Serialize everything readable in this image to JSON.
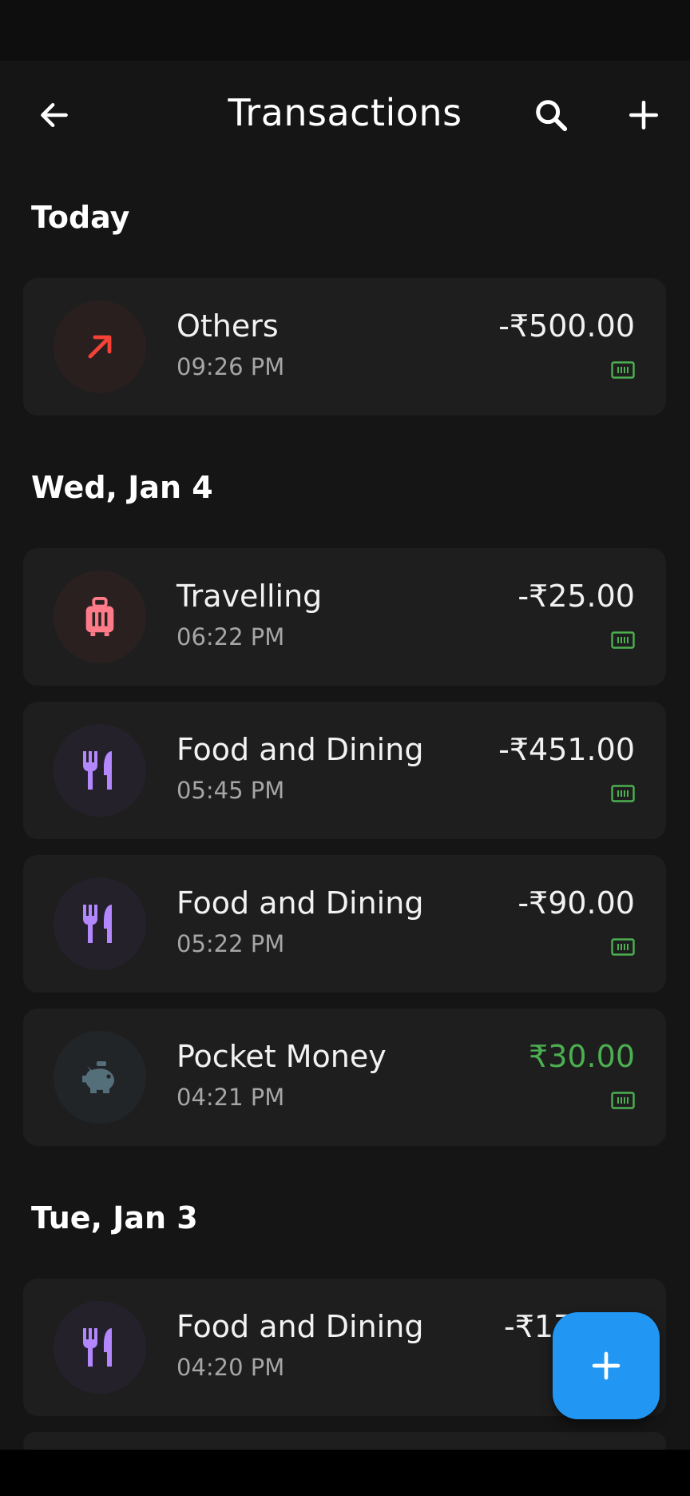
{
  "header": {
    "title": "Transactions"
  },
  "icons": {
    "back": "arrow-left-icon",
    "search": "search-icon",
    "add": "plus-icon",
    "fab": "plus-icon",
    "wallet": "cash-icon"
  },
  "colors": {
    "background": "#151515",
    "card": "#1e1e1f",
    "income": "#4caf50",
    "fab": "#2196f3",
    "wallet": "#4caf50"
  },
  "sections": [
    {
      "label": "Today"
    },
    {
      "label": "Wed, Jan 4"
    },
    {
      "label": "Tue, Jan 3"
    }
  ],
  "transactions": [
    {
      "name": "Others",
      "time": "09:26 PM",
      "amount": "-₹500.00",
      "icon": "arrow-up-right-icon"
    },
    {
      "name": "Travelling",
      "time": "06:22 PM",
      "amount": "-₹25.00",
      "icon": "luggage-icon"
    },
    {
      "name": "Food and Dining",
      "time": "05:45 PM",
      "amount": "-₹451.00",
      "icon": "fork-knife-icon"
    },
    {
      "name": "Food and Dining",
      "time": "05:22 PM",
      "amount": "-₹90.00",
      "icon": "fork-knife-icon"
    },
    {
      "name": "Pocket Money",
      "time": "04:21 PM",
      "amount": "₹30.00",
      "icon": "piggy-bank-icon",
      "type": "income"
    },
    {
      "name": "Food and Dining",
      "time": "04:20 PM",
      "amount": "-₹17",
      "icon": "fork-knife-icon"
    }
  ]
}
